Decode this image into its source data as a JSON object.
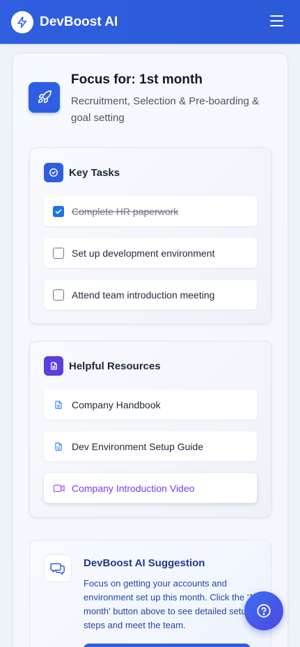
{
  "app": {
    "title": "DevBoost AI",
    "logo_icon": "lightning-icon",
    "menu_icon": "hamburger-menu-icon"
  },
  "focus": {
    "title": "Focus for: 1st month",
    "subtitle": "Recruitment, Selection & Pre-boarding & goal setting",
    "icon": "rocket-icon"
  },
  "tasks": {
    "title": "Key Tasks",
    "icon": "check-circle-icon",
    "items": [
      {
        "label": "Complete HR paperwork",
        "checked": true
      },
      {
        "label": "Set up development environment",
        "checked": false
      },
      {
        "label": "Attend team introduction meeting",
        "checked": false
      }
    ]
  },
  "resources": {
    "title": "Helpful Resources",
    "icon": "document-icon",
    "items": [
      {
        "label": "Company Handbook",
        "icon": "document-icon"
      },
      {
        "label": "Dev Environment Setup Guide",
        "icon": "document-icon"
      },
      {
        "label": "Company Introduction Video",
        "icon": "video-icon"
      }
    ]
  },
  "suggestion": {
    "title": "DevBoost AI Suggestion",
    "text": "Focus on getting your accounts and environment set up this month. Click the '1st month' button above to see detailed setup steps and meet the team.",
    "icon": "chat-bubbles-icon"
  },
  "help_fab": {
    "icon": "help-circle-icon"
  },
  "colors": {
    "primary": "#2f5fe0",
    "accent_purple": "#7c3aed",
    "check_blue": "#1a73e8"
  }
}
